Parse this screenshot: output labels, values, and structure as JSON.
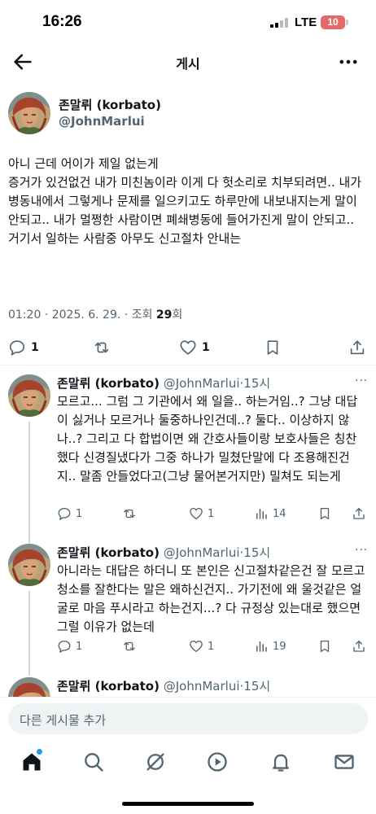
{
  "status_bar": {
    "time": "16:26",
    "network": "LTE",
    "battery": "10"
  },
  "header": {
    "title": "게시"
  },
  "main_post": {
    "author_name": "존말뤼 (korbato)",
    "author_handle": "@JohnMarlui",
    "text": "아니 근데 어이가 제일 없는게\n증거가 있건없건 내가 미친놈이라 이게 다 헛소리로 치부되려면.. 내가 병동내에서 그렇게나 문제를 일으키고도 하루만에 내보내지는게 말이 안되고.. 내가 멀쩡한 사람이면 폐쇄병동에 들어가진게 말이 안되고..\n거기서 일하는 사람중 아무도 신고절차 안내는",
    "time": "01:20",
    "date": "2025. 6. 29.",
    "views_label": "조회",
    "views": "29",
    "views_suffix": "회",
    "replies": "1",
    "likes": "1"
  },
  "replies": [
    {
      "author_name": "존말뤼 (korbato)",
      "author_handle": "@JohnMarlui",
      "time": "15시",
      "text": "모르고... 그럼 그 기관에서 왜 일을.. 하는거임..? 그냥 대답이 싫거나 모르거나 둘중하나인건데..? 둘다.. 이상하지 않나..? 그리고 다 합법이면 왜 간호사들이랑 보호사들은 칭찬했다 신경질냈다가 그중 하나가 밀쳤단말에 다 조용해진건지.. 말좀 안들었다고(그냥 물어본거지만) 밀쳐도 되는게",
      "replies": "1",
      "likes": "1",
      "views": "14"
    },
    {
      "author_name": "존말뤼 (korbato)",
      "author_handle": "@JohnMarlui",
      "time": "15시",
      "text": "아니라는 대답은 하더니 또 본인은 신고절차같은건 잘 모르고 청소를 잘한다는 말은 왜하신건지.. 가기전에 왜 울것같은 얼굴로 마음 푸시라고 하는건지...? 다 규정상 있는대로 했으면 그럴 이유가 없는데",
      "replies": "1",
      "likes": "1",
      "views": "19"
    },
    {
      "author_name": "존말뤼 (korbato)",
      "author_handle": "@JohnMarlui",
      "time": "15시"
    }
  ],
  "compose": {
    "placeholder": "다른 게시물 추가"
  },
  "bottom_nav": [
    {
      "name": "home-icon"
    },
    {
      "name": "search-icon"
    },
    {
      "name": "grok-icon"
    },
    {
      "name": "play-icon"
    },
    {
      "name": "bell-icon"
    },
    {
      "name": "mail-icon"
    }
  ],
  "colors": {
    "text": "#0f1419",
    "secondary": "#536471",
    "accent": "#1d9bf0",
    "divider": "#eff3f4"
  }
}
